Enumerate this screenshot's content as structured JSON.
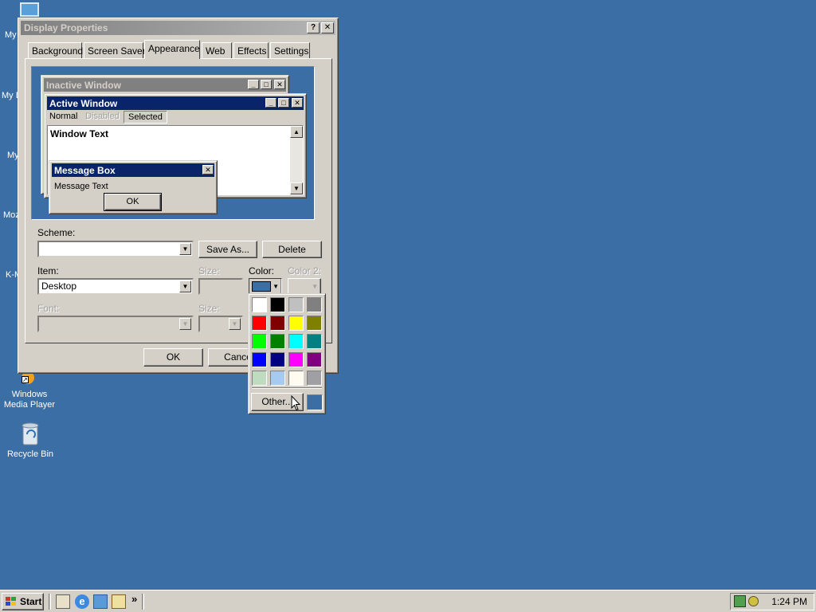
{
  "desktop": {
    "icons": [
      {
        "label_lines": [
          "Windows",
          "Media Player"
        ]
      },
      {
        "label_lines": [
          "Recycle Bin"
        ]
      }
    ],
    "clipped_labels": [
      "My",
      "My D",
      "My",
      "Moz",
      "K-M"
    ]
  },
  "dialog": {
    "title": "Display Properties",
    "help_glyph": "?",
    "close_glyph": "✕",
    "tabs": [
      "Background",
      "Screen Saver",
      "Appearance",
      "Web",
      "Effects",
      "Settings"
    ],
    "active_tab": "Appearance",
    "preview": {
      "inactive_title": "Inactive Window",
      "active_title": "Active Window",
      "menu_items": [
        "Normal",
        "Disabled",
        "Selected"
      ],
      "window_text": "Window Text",
      "message_title": "Message Box",
      "message_text": "Message Text",
      "ok_label": "OK"
    },
    "scheme_label": "Scheme:",
    "scheme_value": "",
    "save_as_label": "Save As...",
    "delete_label": "Delete",
    "item_label": "Item:",
    "item_value": "Desktop",
    "size_label": "Size:",
    "color_label": "Color:",
    "color2_label": "Color 2:",
    "font_label": "Font:",
    "font_size_label": "Size:",
    "ok_label": "OK",
    "cancel_label": "Cance",
    "current_color": "#3a6ea5"
  },
  "color_popup": {
    "swatches": [
      "#ffffff",
      "#000000",
      "#c0c0c0",
      "#808080",
      "#ff0000",
      "#800000",
      "#ffff00",
      "#808000",
      "#00ff00",
      "#008000",
      "#00ffff",
      "#008080",
      "#0000ff",
      "#000080",
      "#ff00ff",
      "#800080",
      "#c0dcc0",
      "#a6caf0",
      "#fffbf0",
      "#a0a0a4"
    ],
    "other_label": "Other...",
    "custom_color": "#3a6ea5"
  },
  "taskbar": {
    "start_label": "Start",
    "quick_launch_more": "»",
    "clock": "1:24 PM"
  }
}
